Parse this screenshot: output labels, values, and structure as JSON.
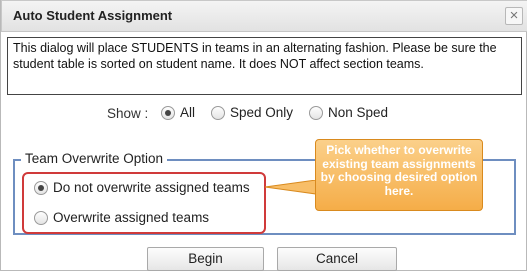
{
  "dialog": {
    "title": "Auto Student Assignment",
    "close_glyph": "×",
    "description": "This dialog will place STUDENTS in teams in an alternating fashion. Please be sure the student table is sorted on student name. It does NOT affect section teams.",
    "show": {
      "label": "Show :",
      "options": [
        {
          "label": "All",
          "checked": true
        },
        {
          "label": "Sped Only",
          "checked": false
        },
        {
          "label": "Non Sped",
          "checked": false
        }
      ]
    },
    "team_overwrite": {
      "legend": "Team Overwrite Option",
      "options": [
        {
          "label": "Do not overwrite assigned teams",
          "checked": true
        },
        {
          "label": "Overwrite assigned teams",
          "checked": false
        }
      ]
    },
    "callout_text": "Pick whether to overwrite existing team assignments by choosing desired option here.",
    "buttons": {
      "begin": "Begin",
      "cancel": "Cancel"
    }
  },
  "colors": {
    "callout": "#f5ad48",
    "highlight_border": "#d03a3a",
    "fieldset_border": "#6e8ec0"
  }
}
